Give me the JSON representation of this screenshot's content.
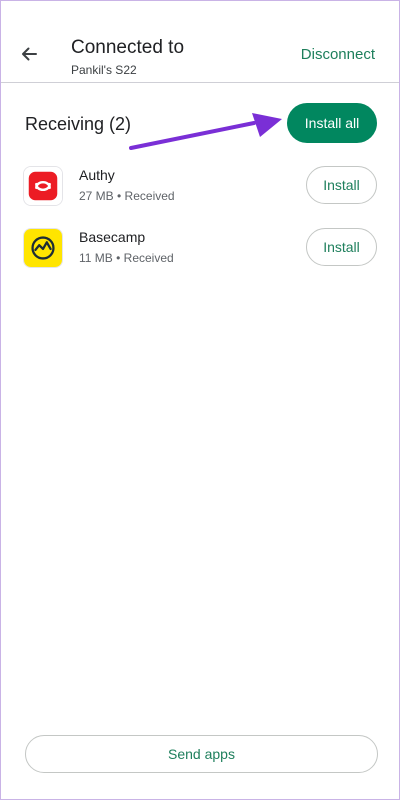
{
  "header": {
    "title": "Connected to",
    "subtitle": "Pankil's S22",
    "disconnect_label": "Disconnect",
    "back_icon": "back-arrow-icon"
  },
  "receiving": {
    "title": "Receiving (2)",
    "install_all_label": "Install all"
  },
  "apps": [
    {
      "name": "Authy",
      "meta": "27 MB • Received",
      "install_label": "Install",
      "icon": "authy-icon",
      "icon_color": "#ec1c24"
    },
    {
      "name": "Basecamp",
      "meta": "11 MB • Received",
      "install_label": "Install",
      "icon": "basecamp-icon",
      "icon_color": "#ffe500"
    }
  ],
  "footer": {
    "send_apps_label": "Send apps"
  },
  "colors": {
    "accent": "#01875f",
    "accent_text": "#1e7f5c",
    "annotation_arrow": "#7a2fd6"
  }
}
